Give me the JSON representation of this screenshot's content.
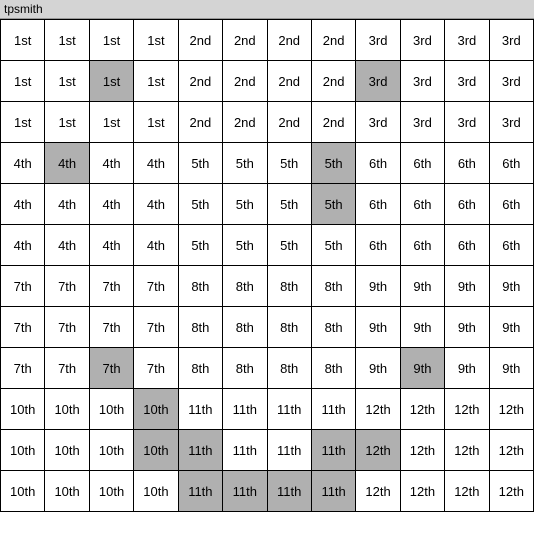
{
  "title": "tpsmith",
  "grid": {
    "rows": [
      [
        {
          "text": "1st",
          "bg": "normal"
        },
        {
          "text": "1st",
          "bg": "normal"
        },
        {
          "text": "1st",
          "bg": "normal"
        },
        {
          "text": "1st",
          "bg": "normal"
        },
        {
          "text": "2nd",
          "bg": "normal"
        },
        {
          "text": "2nd",
          "bg": "normal"
        },
        {
          "text": "2nd",
          "bg": "normal"
        },
        {
          "text": "2nd",
          "bg": "normal"
        },
        {
          "text": "3rd",
          "bg": "normal"
        },
        {
          "text": "3rd",
          "bg": "normal"
        },
        {
          "text": "3rd",
          "bg": "normal"
        },
        {
          "text": "3rd",
          "bg": "normal"
        }
      ],
      [
        {
          "text": "1st",
          "bg": "normal"
        },
        {
          "text": "1st",
          "bg": "normal"
        },
        {
          "text": "1st",
          "bg": "highlighted"
        },
        {
          "text": "1st",
          "bg": "normal"
        },
        {
          "text": "2nd",
          "bg": "normal"
        },
        {
          "text": "2nd",
          "bg": "normal"
        },
        {
          "text": "2nd",
          "bg": "normal"
        },
        {
          "text": "2nd",
          "bg": "normal"
        },
        {
          "text": "3rd",
          "bg": "highlighted"
        },
        {
          "text": "3rd",
          "bg": "normal"
        },
        {
          "text": "3rd",
          "bg": "normal"
        },
        {
          "text": "3rd",
          "bg": "normal"
        }
      ],
      [
        {
          "text": "1st",
          "bg": "normal"
        },
        {
          "text": "1st",
          "bg": "normal"
        },
        {
          "text": "1st",
          "bg": "normal"
        },
        {
          "text": "1st",
          "bg": "normal"
        },
        {
          "text": "2nd",
          "bg": "normal"
        },
        {
          "text": "2nd",
          "bg": "normal"
        },
        {
          "text": "2nd",
          "bg": "normal"
        },
        {
          "text": "2nd",
          "bg": "normal"
        },
        {
          "text": "3rd",
          "bg": "normal"
        },
        {
          "text": "3rd",
          "bg": "normal"
        },
        {
          "text": "3rd",
          "bg": "normal"
        },
        {
          "text": "3rd",
          "bg": "normal"
        }
      ],
      [
        {
          "text": "4th",
          "bg": "normal"
        },
        {
          "text": "4th",
          "bg": "highlighted"
        },
        {
          "text": "4th",
          "bg": "normal"
        },
        {
          "text": "4th",
          "bg": "normal"
        },
        {
          "text": "5th",
          "bg": "normal"
        },
        {
          "text": "5th",
          "bg": "normal"
        },
        {
          "text": "5th",
          "bg": "normal"
        },
        {
          "text": "5th",
          "bg": "highlighted"
        },
        {
          "text": "6th",
          "bg": "normal"
        },
        {
          "text": "6th",
          "bg": "normal"
        },
        {
          "text": "6th",
          "bg": "normal"
        },
        {
          "text": "6th",
          "bg": "normal"
        }
      ],
      [
        {
          "text": "4th",
          "bg": "normal"
        },
        {
          "text": "4th",
          "bg": "normal"
        },
        {
          "text": "4th",
          "bg": "normal"
        },
        {
          "text": "4th",
          "bg": "normal"
        },
        {
          "text": "5th",
          "bg": "normal"
        },
        {
          "text": "5th",
          "bg": "normal"
        },
        {
          "text": "5th",
          "bg": "normal"
        },
        {
          "text": "5th",
          "bg": "highlighted"
        },
        {
          "text": "6th",
          "bg": "normal"
        },
        {
          "text": "6th",
          "bg": "normal"
        },
        {
          "text": "6th",
          "bg": "normal"
        },
        {
          "text": "6th",
          "bg": "normal"
        }
      ],
      [
        {
          "text": "4th",
          "bg": "normal"
        },
        {
          "text": "4th",
          "bg": "normal"
        },
        {
          "text": "4th",
          "bg": "normal"
        },
        {
          "text": "4th",
          "bg": "normal"
        },
        {
          "text": "5th",
          "bg": "normal"
        },
        {
          "text": "5th",
          "bg": "normal"
        },
        {
          "text": "5th",
          "bg": "normal"
        },
        {
          "text": "5th",
          "bg": "normal"
        },
        {
          "text": "6th",
          "bg": "normal"
        },
        {
          "text": "6th",
          "bg": "normal"
        },
        {
          "text": "6th",
          "bg": "normal"
        },
        {
          "text": "6th",
          "bg": "normal"
        }
      ],
      [
        {
          "text": "7th",
          "bg": "normal"
        },
        {
          "text": "7th",
          "bg": "normal"
        },
        {
          "text": "7th",
          "bg": "normal"
        },
        {
          "text": "7th",
          "bg": "normal"
        },
        {
          "text": "8th",
          "bg": "normal"
        },
        {
          "text": "8th",
          "bg": "normal"
        },
        {
          "text": "8th",
          "bg": "normal"
        },
        {
          "text": "8th",
          "bg": "normal"
        },
        {
          "text": "9th",
          "bg": "normal"
        },
        {
          "text": "9th",
          "bg": "normal"
        },
        {
          "text": "9th",
          "bg": "normal"
        },
        {
          "text": "9th",
          "bg": "normal"
        }
      ],
      [
        {
          "text": "7th",
          "bg": "normal"
        },
        {
          "text": "7th",
          "bg": "normal"
        },
        {
          "text": "7th",
          "bg": "normal"
        },
        {
          "text": "7th",
          "bg": "normal"
        },
        {
          "text": "8th",
          "bg": "normal"
        },
        {
          "text": "8th",
          "bg": "normal"
        },
        {
          "text": "8th",
          "bg": "normal"
        },
        {
          "text": "8th",
          "bg": "normal"
        },
        {
          "text": "9th",
          "bg": "normal"
        },
        {
          "text": "9th",
          "bg": "normal"
        },
        {
          "text": "9th",
          "bg": "normal"
        },
        {
          "text": "9th",
          "bg": "normal"
        }
      ],
      [
        {
          "text": "7th",
          "bg": "normal"
        },
        {
          "text": "7th",
          "bg": "normal"
        },
        {
          "text": "7th",
          "bg": "highlighted"
        },
        {
          "text": "7th",
          "bg": "normal"
        },
        {
          "text": "8th",
          "bg": "normal"
        },
        {
          "text": "8th",
          "bg": "normal"
        },
        {
          "text": "8th",
          "bg": "normal"
        },
        {
          "text": "8th",
          "bg": "normal"
        },
        {
          "text": "9th",
          "bg": "normal"
        },
        {
          "text": "9th",
          "bg": "highlighted"
        },
        {
          "text": "9th",
          "bg": "normal"
        },
        {
          "text": "9th",
          "bg": "normal"
        }
      ],
      [
        {
          "text": "10th",
          "bg": "normal"
        },
        {
          "text": "10th",
          "bg": "normal"
        },
        {
          "text": "10th",
          "bg": "normal"
        },
        {
          "text": "10th",
          "bg": "highlighted"
        },
        {
          "text": "11th",
          "bg": "normal"
        },
        {
          "text": "11th",
          "bg": "normal"
        },
        {
          "text": "11th",
          "bg": "normal"
        },
        {
          "text": "11th",
          "bg": "normal"
        },
        {
          "text": "12th",
          "bg": "normal"
        },
        {
          "text": "12th",
          "bg": "normal"
        },
        {
          "text": "12th",
          "bg": "normal"
        },
        {
          "text": "12th",
          "bg": "normal"
        }
      ],
      [
        {
          "text": "10th",
          "bg": "normal"
        },
        {
          "text": "10th",
          "bg": "normal"
        },
        {
          "text": "10th",
          "bg": "normal"
        },
        {
          "text": "10th",
          "bg": "highlighted"
        },
        {
          "text": "11th",
          "bg": "highlighted"
        },
        {
          "text": "11th",
          "bg": "normal"
        },
        {
          "text": "11th",
          "bg": "normal"
        },
        {
          "text": "11th",
          "bg": "highlighted"
        },
        {
          "text": "12th",
          "bg": "highlighted"
        },
        {
          "text": "12th",
          "bg": "normal"
        },
        {
          "text": "12th",
          "bg": "normal"
        },
        {
          "text": "12th",
          "bg": "normal"
        }
      ],
      [
        {
          "text": "10th",
          "bg": "normal"
        },
        {
          "text": "10th",
          "bg": "normal"
        },
        {
          "text": "10th",
          "bg": "normal"
        },
        {
          "text": "10th",
          "bg": "normal"
        },
        {
          "text": "11th",
          "bg": "highlighted"
        },
        {
          "text": "11th",
          "bg": "highlighted"
        },
        {
          "text": "11th",
          "bg": "highlighted"
        },
        {
          "text": "11th",
          "bg": "highlighted"
        },
        {
          "text": "12th",
          "bg": "normal"
        },
        {
          "text": "12th",
          "bg": "normal"
        },
        {
          "text": "12th",
          "bg": "normal"
        },
        {
          "text": "12th",
          "bg": "normal"
        }
      ]
    ]
  }
}
